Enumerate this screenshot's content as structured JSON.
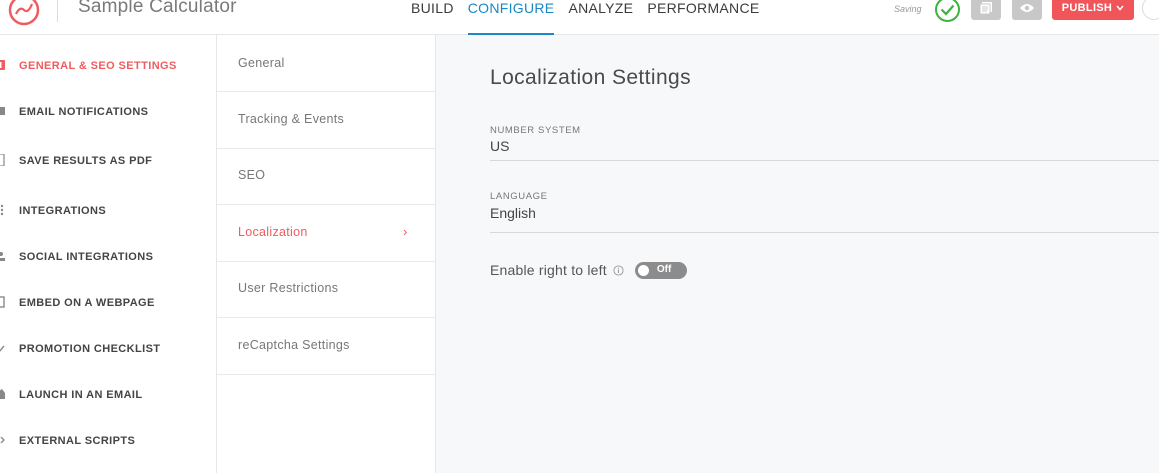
{
  "header": {
    "app_title": "Sample Calculator",
    "nav_tabs": [
      {
        "label": "BUILD"
      },
      {
        "label": "CONFIGURE"
      },
      {
        "label": "ANALYZE"
      },
      {
        "label": "PERFORMANCE"
      }
    ],
    "active_tab": "CONFIGURE",
    "saving_text": "Saving",
    "publish_label": "PUBLISH",
    "icons": {
      "logo": "gauge-logo-icon",
      "status": "check-circle-icon",
      "copy": "copy-icon",
      "preview": "eye-icon",
      "publish_dropdown": "chevron-down-icon"
    }
  },
  "sidebar": {
    "items": [
      {
        "label": "GENERAL & SEO SETTINGS",
        "icon": "settings-icon"
      },
      {
        "label": "EMAIL NOTIFICATIONS",
        "icon": "email-icon"
      },
      {
        "label": "SAVE RESULTS AS PDF",
        "icon": "pdf-icon"
      },
      {
        "label": "INTEGRATIONS",
        "icon": "integrations-icon"
      },
      {
        "label": "SOCIAL INTEGRATIONS",
        "icon": "social-icon"
      },
      {
        "label": "EMBED ON A WEBPAGE",
        "icon": "embed-icon"
      },
      {
        "label": "PROMOTION CHECKLIST",
        "icon": "checklist-icon"
      },
      {
        "label": "LAUNCH IN AN EMAIL",
        "icon": "launch-email-icon"
      },
      {
        "label": "EXTERNAL SCRIPTS",
        "icon": "code-icon"
      }
    ],
    "active_index": 0
  },
  "subnav": {
    "items": [
      {
        "label": "General"
      },
      {
        "label": "Tracking & Events"
      },
      {
        "label": "SEO"
      },
      {
        "label": "Localization"
      },
      {
        "label": "User Restrictions"
      },
      {
        "label": "reCaptcha Settings"
      }
    ],
    "active_index": 3,
    "chevron": "›"
  },
  "main": {
    "title": "Localization Settings",
    "number_system": {
      "label": "NUMBER SYSTEM",
      "value": "US"
    },
    "language": {
      "label": "LANGUAGE",
      "value": "English"
    },
    "rtl": {
      "label": "Enable right to left",
      "toggle_text": "Off",
      "enabled": false
    }
  },
  "colors": {
    "accent_blue": "#1a88c4",
    "accent_red": "#ef5b5f",
    "publish_red": "#f0555a",
    "check_green": "#3cb33c"
  }
}
